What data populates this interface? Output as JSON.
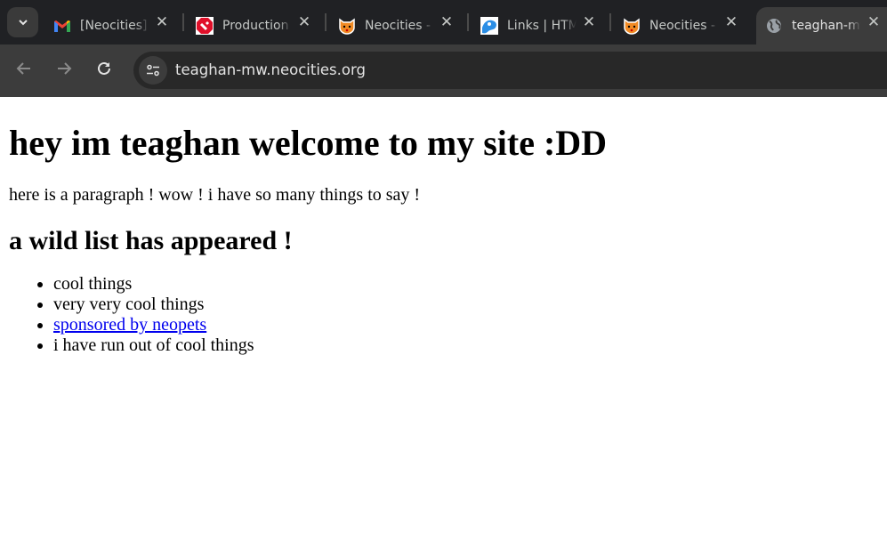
{
  "browser": {
    "tabs": [
      {
        "title": "[Neocities]",
        "icon": "gmail-icon"
      },
      {
        "title": "Production",
        "icon": "production-icon"
      },
      {
        "title": "Neocities -",
        "icon": "neocities-cat-icon"
      },
      {
        "title": "Links | HTML",
        "icon": "links-icon"
      },
      {
        "title": "Neocities -",
        "icon": "neocities-cat-icon"
      },
      {
        "title": "teaghan-mw",
        "icon": "globe-icon",
        "active": true
      }
    ],
    "url": "teaghan-mw.neocities.org",
    "colors": {
      "tabstrip": "#202124",
      "toolbar": "#3c3c3c",
      "omnibox": "#282828"
    }
  },
  "page": {
    "heading": "hey im teaghan welcome to my site :DD",
    "paragraph": "here is a paragraph ! wow ! i have so many things to say !",
    "subheading": "a wild list has appeared !",
    "list": [
      {
        "text": "cool things"
      },
      {
        "text": "very very cool things"
      },
      {
        "text": "sponsored by neopets",
        "link": true
      },
      {
        "text": "i have run out of cool things"
      }
    ],
    "link_color": "#0000ee"
  }
}
